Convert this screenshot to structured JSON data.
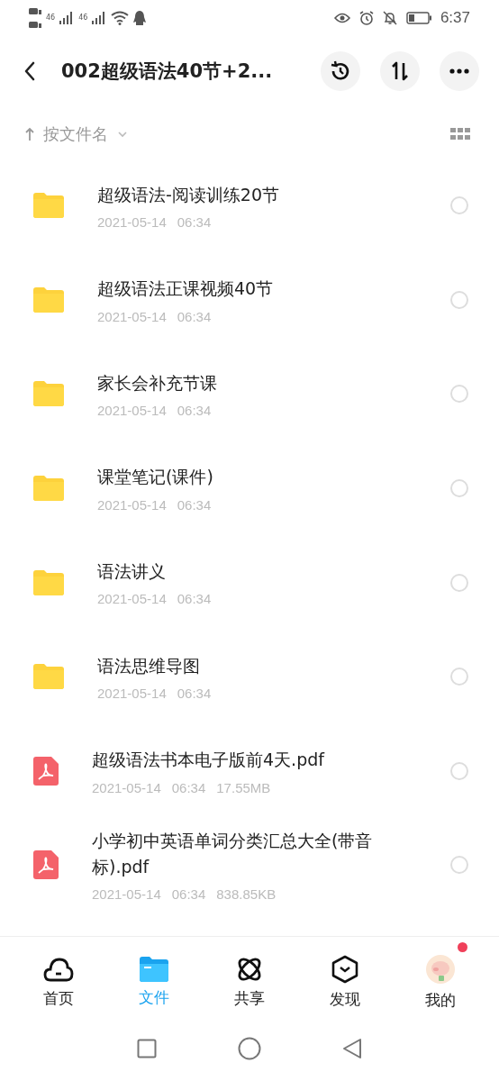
{
  "status_bar": {
    "network_labels": [
      "46",
      "46"
    ],
    "time": "6:37"
  },
  "header": {
    "title": "002超级语法40节+2..."
  },
  "sort": {
    "label": "按文件名"
  },
  "files": [
    {
      "kind": "folder",
      "name": "超级语法-阅读训练20节",
      "date": "2021-05-14",
      "time": "06:34",
      "selected": false
    },
    {
      "kind": "folder",
      "name": "超级语法正课视频40节",
      "date": "2021-05-14",
      "time": "06:34",
      "selected": false
    },
    {
      "kind": "folder",
      "name": "家长会补充节课",
      "date": "2021-05-14",
      "time": "06:34",
      "selected": false
    },
    {
      "kind": "folder",
      "name": "课堂笔记(课件)",
      "date": "2021-05-14",
      "time": "06:34",
      "selected": false
    },
    {
      "kind": "folder",
      "name": "语法讲义",
      "date": "2021-05-14",
      "time": "06:34",
      "selected": false
    },
    {
      "kind": "folder",
      "name": "语法思维导图",
      "date": "2021-05-14",
      "time": "06:34",
      "selected": false
    },
    {
      "kind": "pdf",
      "name": "超级语法书本电子版前4天.pdf",
      "date": "2021-05-14",
      "time": "06:34",
      "size": "17.55MB",
      "selected": false
    },
    {
      "kind": "pdf",
      "name": "小学初中英语单词分类汇总大全(带音标).pdf",
      "date": "2021-05-14",
      "time": "06:34",
      "size": "838.85KB",
      "selected": false
    }
  ],
  "tabs": [
    {
      "kind": "home",
      "label": "首页",
      "selected": false
    },
    {
      "kind": "files",
      "label": "文件",
      "selected": true
    },
    {
      "kind": "share",
      "label": "共享",
      "selected": false
    },
    {
      "kind": "discover",
      "label": "发现",
      "selected": false
    },
    {
      "kind": "me",
      "label": "我的",
      "selected": false,
      "badge": true
    }
  ]
}
